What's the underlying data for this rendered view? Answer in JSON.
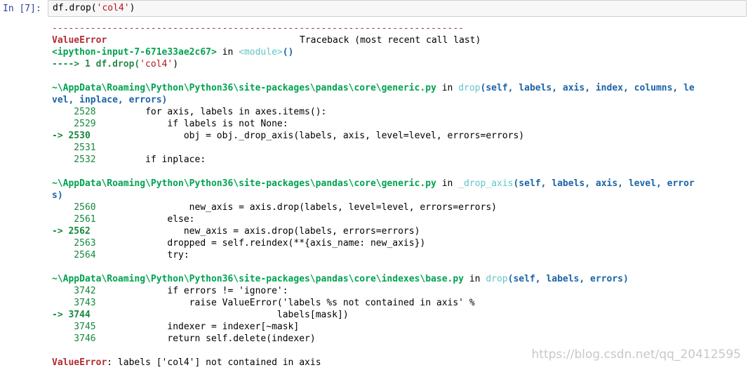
{
  "cell": {
    "prompt": "In [7]:",
    "code_pre": "df.drop(",
    "code_str": "'col4'",
    "code_post": ")"
  },
  "traceback": {
    "separator": "---------------------------------------------------------------------------",
    "error_name": "ValueError",
    "header_right": "Traceback (most recent call last)",
    "input_ref": "<ipython-input-7-671e33ae2c67>",
    "in_word": " in ",
    "module": "<module>",
    "module_call": "()",
    "arrow_line_prefix": "----> 1 df.drop(",
    "arrow_line_str": "'col4'",
    "arrow_line_post": ")",
    "frames": [
      {
        "path": "~\\AppData\\Roaming\\Python\\Python36\\site-packages\\pandas\\core\\generic.py",
        "func": "drop",
        "sig": "(self, labels, axis, index, columns, le",
        "sig_wrap": "vel, inplace, errors)",
        "lines": [
          {
            "no": "    2528",
            "code": "         for axis, labels in axes.items():"
          },
          {
            "no": "    2529",
            "code": "             if labels is not None:"
          },
          {
            "no": "-> 2530",
            "code": "                 obj = obj._drop_axis(labels, axis, level=level, errors=errors)"
          },
          {
            "no": "    2531",
            "code": ""
          },
          {
            "no": "    2532",
            "code": "         if inplace:"
          }
        ]
      },
      {
        "path": "~\\AppData\\Roaming\\Python\\Python36\\site-packages\\pandas\\core\\generic.py",
        "func": "_drop_axis",
        "sig": "(self, labels, axis, level, error",
        "sig_wrap": "s)",
        "lines": [
          {
            "no": "    2560",
            "code": "                 new_axis = axis.drop(labels, level=level, errors=errors)"
          },
          {
            "no": "    2561",
            "code": "             else:"
          },
          {
            "no": "-> 2562",
            "code": "                 new_axis = axis.drop(labels, errors=errors)"
          },
          {
            "no": "    2563",
            "code": "             dropped = self.reindex(**{axis_name: new_axis})"
          },
          {
            "no": "    2564",
            "code": "             try:"
          }
        ]
      },
      {
        "path": "~\\AppData\\Roaming\\Python\\Python36\\site-packages\\pandas\\core\\indexes\\base.py",
        "func": "drop",
        "sig": "(self, labels, errors)",
        "sig_wrap": "",
        "lines": [
          {
            "no": "    3742",
            "code": "             if errors != 'ignore':"
          },
          {
            "no": "    3743",
            "code": "                 raise ValueError('labels %s not contained in axis' %"
          },
          {
            "no": "-> 3744",
            "code": "                                  labels[mask])"
          },
          {
            "no": "    3745",
            "code": "             indexer = indexer[~mask]"
          },
          {
            "no": "    3746",
            "code": "             return self.delete(indexer)"
          }
        ]
      }
    ],
    "final_error_name": "ValueError",
    "final_message": ": labels ['col4'] not contained in axis"
  },
  "watermark": "https://blog.csdn.net/qq_20412595"
}
